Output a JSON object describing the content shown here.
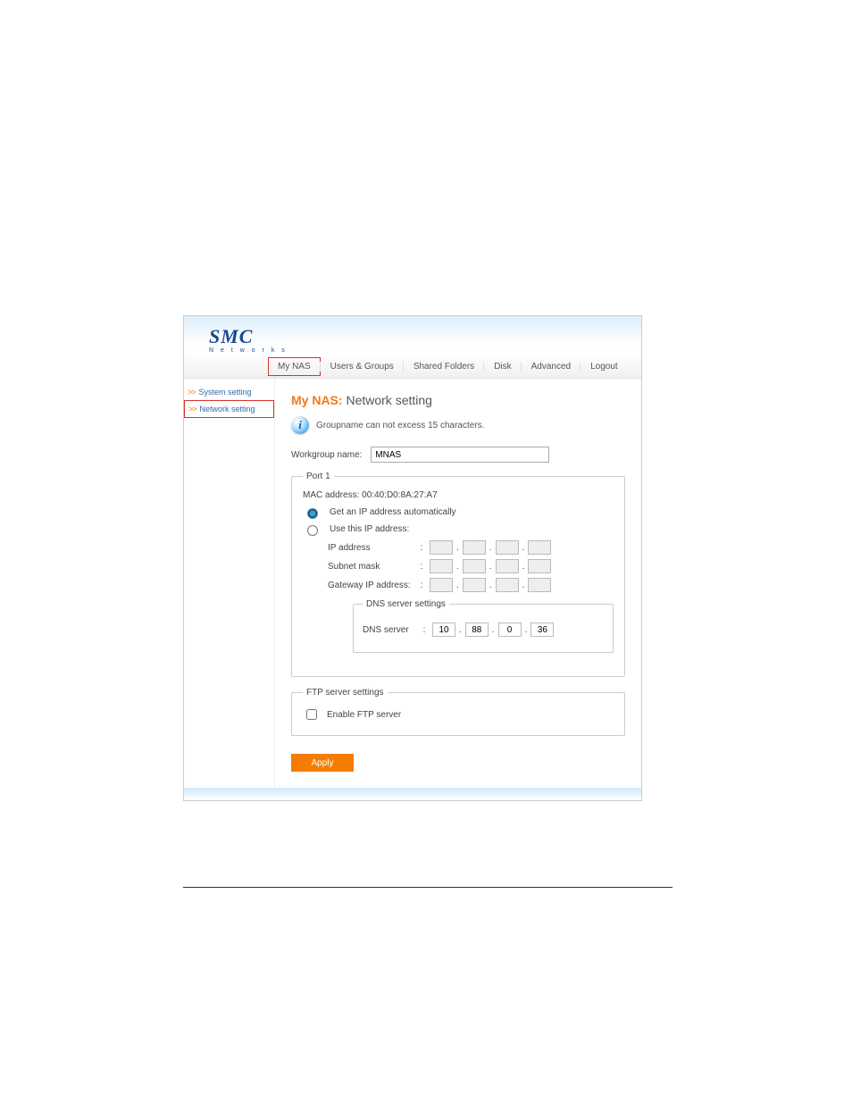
{
  "logo": {
    "main": "SMC",
    "sub": "N e t w o r k s"
  },
  "tabs": [
    {
      "label": "My NAS",
      "active": true
    },
    {
      "label": "Users & Groups",
      "active": false
    },
    {
      "label": "Shared Folders",
      "active": false
    },
    {
      "label": "Disk",
      "active": false
    },
    {
      "label": "Advanced",
      "active": false
    },
    {
      "label": "Logout",
      "active": false
    }
  ],
  "sidebar": [
    {
      "label": "System setting",
      "active": false
    },
    {
      "label": "Network setting",
      "active": true
    }
  ],
  "heading": {
    "prefix": "My NAS:",
    "title": "Network setting"
  },
  "info_text": "Groupname can not excess 15 characters.",
  "workgroup": {
    "label": "Workgroup name:",
    "value": "MNAS"
  },
  "port1": {
    "legend": "Port 1",
    "mac_label": "MAC address:",
    "mac_value": "00:40:D0:8A:27:A7",
    "radio_auto": "Get an IP address automatically",
    "radio_manual": "Use this IP address:",
    "ip_mode": "auto",
    "rows": {
      "ip": {
        "label": "IP address",
        "octets": [
          "",
          "",
          "",
          ""
        ]
      },
      "mask": {
        "label": "Subnet mask",
        "octets": [
          "",
          "",
          "",
          ""
        ]
      },
      "gateway": {
        "label": "Gateway IP address:",
        "octets": [
          "",
          "",
          "",
          ""
        ]
      }
    },
    "dns": {
      "legend": "DNS server settings",
      "label": "DNS server",
      "octets": [
        "10",
        "88",
        "0",
        "36"
      ]
    }
  },
  "ftp": {
    "legend": "FTP server settings",
    "checkbox_label": "Enable FTP server",
    "checked": false
  },
  "apply_label": "Apply"
}
